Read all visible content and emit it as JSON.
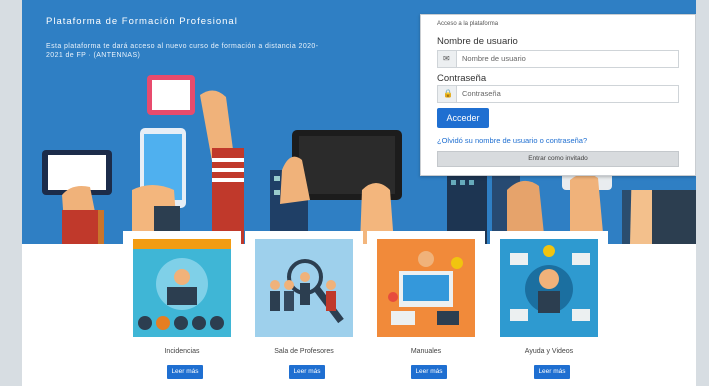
{
  "hero": {
    "title": "Plataforma de Formación Profesional",
    "description": "Esta plataforma te dará acceso al nuevo curso de formación a distancia 2020-2021 de FP · (ANTENNAS)"
  },
  "login": {
    "header": "Acceso a la plataforma",
    "username_label": "Nombre de usuario",
    "username_placeholder": "Nombre de usuario",
    "password_label": "Contraseña",
    "password_placeholder": "Contraseña",
    "submit_label": "Acceder",
    "forgot_prefix": "¿Olvidó su",
    "forgot_user": "nombre de usuario",
    "forgot_or": "o",
    "forgot_pass": "contraseña",
    "forgot_suffix": "?",
    "guest_label": "Entrar como invitado"
  },
  "cards": [
    {
      "caption": "Incidencias",
      "button": "Leer más"
    },
    {
      "caption": "Sala de Profesores",
      "button": "Leer más"
    },
    {
      "caption": "Manuales",
      "button": "Leer más"
    },
    {
      "caption": "Ayuda y Videos",
      "button": "Leer más"
    }
  ],
  "colors": {
    "hero_blue": "#2f7fc4",
    "accent": "#1f6fd1",
    "card1_bg": "#3fb6d6",
    "card2_bg": "#9ed0ec",
    "card3_bg": "#f18a3a",
    "card4_bg": "#2e9ad0"
  }
}
